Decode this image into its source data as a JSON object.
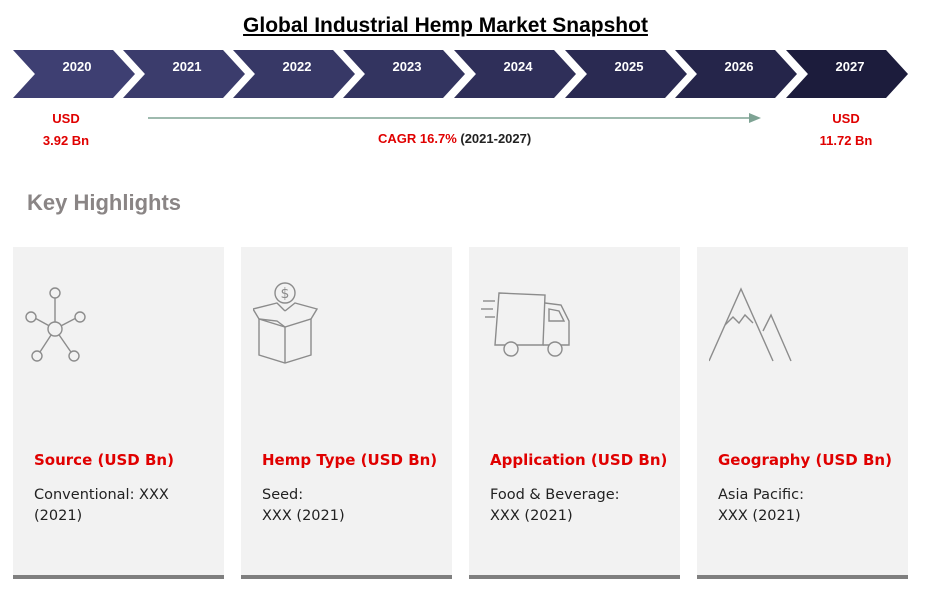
{
  "title": "Global Industrial Hemp Market Snapshot",
  "timeline": {
    "years": [
      "2020",
      "2021",
      "2022",
      "2023",
      "2024",
      "2025",
      "2026",
      "2027"
    ],
    "colors": [
      "#3e3f72",
      "#3b3c6c",
      "#373866",
      "#333460",
      "#2f2f59",
      "#2a2a52",
      "#25254a",
      "#1c1c3c"
    ]
  },
  "start_value": {
    "unit": "USD",
    "value": "3.92  Bn"
  },
  "end_value": {
    "unit": "USD",
    "value": "11.72  Bn"
  },
  "cagr": {
    "label": "CAGR 16.7%",
    "period": "(2021-2027)"
  },
  "highlights_title": "Key Highlights",
  "cards": [
    {
      "icon": "network-icon",
      "heading": "Source (USD Bn)",
      "body": "Conventional: XXX\n(2021)"
    },
    {
      "icon": "money-box-icon",
      "heading": "Hemp Type (USD Bn)",
      "body": "Seed:\nXXX (2021)"
    },
    {
      "icon": "delivery-truck-icon",
      "heading": "Application (USD Bn)",
      "body": "Food & Beverage:\nXXX (2021)"
    },
    {
      "icon": "mountain-icon",
      "heading": "Geography (USD Bn)",
      "body": "Asia Pacific:\nXXX (2021)"
    }
  ]
}
